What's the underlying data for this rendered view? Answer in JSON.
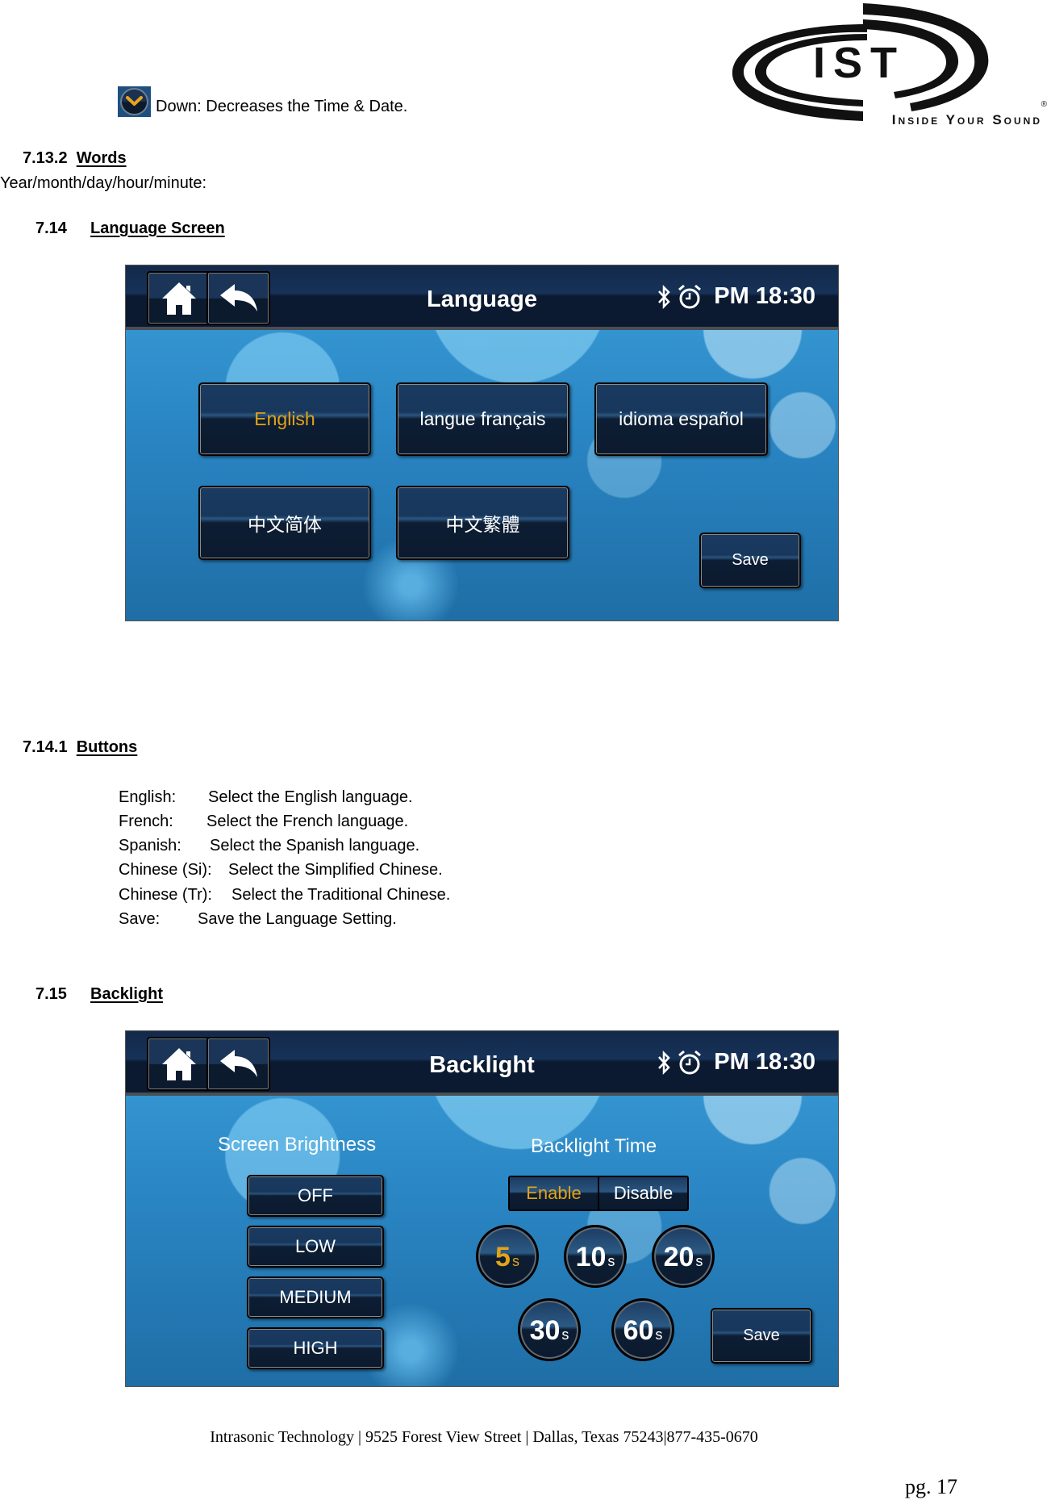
{
  "logo": {
    "letters": "IST",
    "tagline": "Inside Your Sound",
    "registered": "®"
  },
  "intro": {
    "down_icon": "down-chevron-icon",
    "down_text": "Down:  Decreases the Time & Date."
  },
  "section_7_13_2": {
    "number": "7.13.2",
    "title": "Words",
    "body": "Year/month/day/hour/minute:"
  },
  "section_7_14": {
    "number": "7.14",
    "title": "Language Screen"
  },
  "language_screen": {
    "title": "Language",
    "status_icons": [
      "bluetooth-icon",
      "alarm-clock-icon"
    ],
    "time": "PM 18:30",
    "home_icon": "home-icon",
    "back_icon": "back-arrow-icon",
    "buttons": [
      {
        "label": "English",
        "selected": true
      },
      {
        "label": "langue français",
        "selected": false
      },
      {
        "label": "idioma español",
        "selected": false
      },
      {
        "label": "中文简体",
        "selected": false
      },
      {
        "label": "中文繁體",
        "selected": false
      }
    ],
    "save_label": "Save",
    "accent_color": "#e2a317"
  },
  "section_7_14_1": {
    "number": "7.14.1",
    "title": "Buttons",
    "items": [
      {
        "name": "English:",
        "desc": "Select the English language."
      },
      {
        "name": "French:",
        "desc": "Select the French language."
      },
      {
        "name": "Spanish:",
        "desc": "Select the Spanish language."
      },
      {
        "name": "Chinese (Si):",
        "desc": "Select the Simplified Chinese."
      },
      {
        "name": "Chinese (Tr):",
        "desc": "Select the Traditional Chinese."
      },
      {
        "name": "Save:",
        "desc": "Save the Language Setting."
      }
    ]
  },
  "section_7_15": {
    "number": "7.15",
    "title": "Backlight"
  },
  "backlight_screen": {
    "title": "Backlight",
    "time": "PM 18:30",
    "brightness_label": "Screen Brightness",
    "brightness_options": [
      "OFF",
      "LOW",
      "MEDIUM",
      "HIGH"
    ],
    "backlight_time_label": "Backlight Time",
    "toggle": [
      {
        "label": "Enable",
        "selected": true
      },
      {
        "label": "Disable",
        "selected": false
      }
    ],
    "timeouts": [
      {
        "value": "5",
        "unit": "s",
        "selected": true
      },
      {
        "value": "10",
        "unit": "s",
        "selected": false
      },
      {
        "value": "20",
        "unit": "s",
        "selected": false
      },
      {
        "value": "30",
        "unit": "s",
        "selected": false
      },
      {
        "value": "60",
        "unit": "s",
        "selected": false
      }
    ],
    "save_label": "Save"
  },
  "footer": {
    "address": "Intrasonic Technology | 9525 Forest View Street | Dallas, Texas 75243|877-435-0670",
    "page": "pg. 17"
  }
}
